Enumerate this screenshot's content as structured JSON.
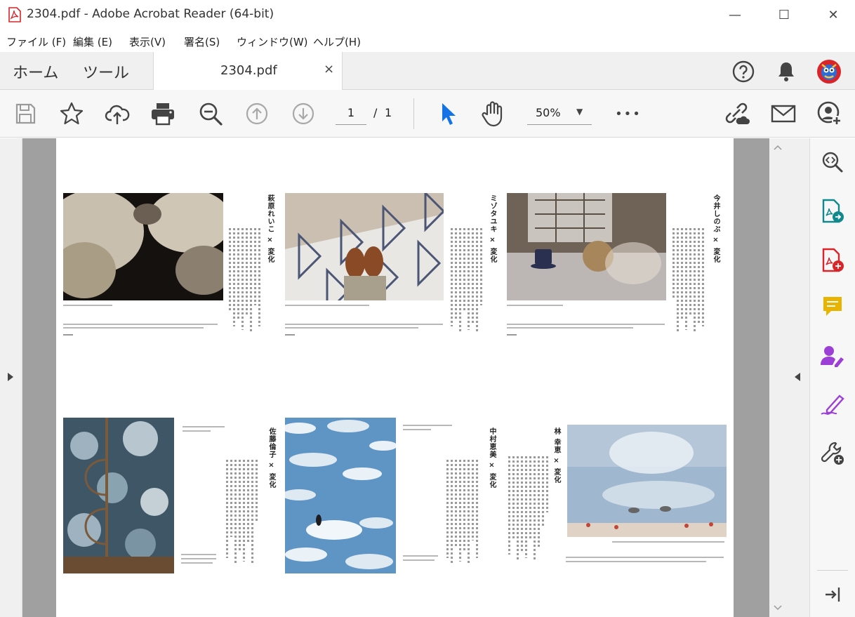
{
  "window": {
    "title": "2304.pdf - Adobe Acrobat Reader (64-bit)",
    "minimize": "—",
    "maximize": "☐",
    "close": "✕"
  },
  "menu": [
    "ファイル (F)",
    "編集 (E)",
    "表示(V)",
    "署名(S)",
    "ウィンドウ(W)",
    "ヘルプ(H)"
  ],
  "tabs": {
    "home": "ホーム",
    "tools": "ツール",
    "document": "2304.pdf",
    "close": "×"
  },
  "toolbar": {
    "page_current": "1",
    "page_sep": "/",
    "page_total": "1",
    "zoom": "50%",
    "more": "•••"
  },
  "icons": {
    "help": "help-icon",
    "bell": "bell-icon",
    "avatar": "avatar-icon"
  },
  "articles": [
    {
      "title": "萩原れいこ × 変化"
    },
    {
      "title": "ミゾタユキ × 変化"
    },
    {
      "title": "今井しのぶ × 変化"
    },
    {
      "title": "佐藤倫子 × 変化"
    },
    {
      "title": "中村恵美 × 変化"
    },
    {
      "title": "林 幸恵 × 変化"
    }
  ],
  "colors": {
    "acrobat_red": "#d7252a",
    "select_blue": "#1473e6",
    "export_teal": "#11898c",
    "comment_yellow": "#e8b400",
    "sign_purple": "#9b3fd6"
  }
}
